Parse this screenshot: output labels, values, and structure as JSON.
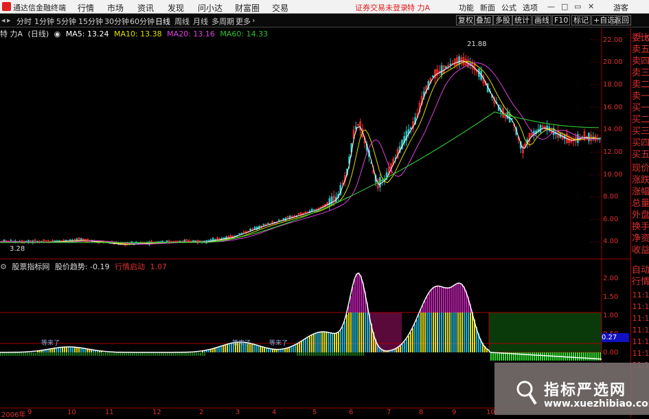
{
  "menubar": {
    "app_title": "通达信金融终端",
    "items": [
      "行情",
      "市场",
      "资讯",
      "发现",
      "问小达",
      "财富圈",
      "交易"
    ],
    "login_note": "证券交易未登录",
    "stock_name": "特 力A",
    "right_items": [
      "功能",
      "新面",
      "公式",
      "选项"
    ],
    "guest": "游客"
  },
  "toolbar": {
    "periods": [
      "分时",
      "1分钟",
      "5分钟",
      "15分钟",
      "30分钟",
      "60分钟",
      "日线",
      "周线",
      "月线",
      "多周期",
      "更多"
    ],
    "active_period": "日线",
    "right_buttons": [
      "复权",
      "叠加",
      "多股",
      "统计",
      "画线",
      "F10",
      "标记",
      "+自选",
      "返回"
    ]
  },
  "main_info": {
    "stock": "特 力A",
    "period_tag": "(日线)",
    "ma5": "MA5: 13.24",
    "ma10": "MA10: 13.38",
    "ma20": "MA20: 13.16",
    "ma60": "MA60: 14.33",
    "high_label": "21.88",
    "low_label": "3.28"
  },
  "indicator_info": {
    "name": "股票指标网",
    "trend_label": "股价趋势: -0.19",
    "signal": "行情启动",
    "signal_value": "1.07",
    "current_value": "0.27",
    "bar_notes": [
      "等来了",
      "等来了",
      "等来了"
    ]
  },
  "price_axis": [
    "22.00",
    "20.00",
    "18.00",
    "16.00",
    "14.00",
    "12.00",
    "10.00",
    "8.00",
    "6.00",
    "4.00"
  ],
  "ind_axis": [
    "2.00",
    "1.50",
    "1.00",
    "0.50",
    "0.00"
  ],
  "x_axis": [
    "2006年",
    "9",
    "10",
    "11",
    "12",
    "2",
    "3",
    "4",
    "5",
    "6",
    "7",
    "8",
    "9",
    "10"
  ],
  "side_tabs": [
    "委比",
    "卖五",
    "卖四",
    "卖三",
    "卖二",
    "卖一",
    "买一",
    "买二",
    "买三",
    "买四",
    "买五",
    "现价",
    "涨跌",
    "涨幅",
    "总量",
    "外盘",
    "换手",
    "净资",
    "收益"
  ],
  "side_tabs2": [
    "自动",
    "行情",
    "11:1",
    "11:1",
    "11:1",
    "11:1",
    "11:1",
    "11:1",
    "11:1"
  ],
  "watermark": {
    "cn": "指标严选网",
    "en": "www.xuezhibiao.com"
  },
  "colors": {
    "up": "#ff3030",
    "down": "#30c0c0",
    "ma5": "#ffffff",
    "ma10": "#e0e000",
    "ma20": "#e040e0",
    "ma60": "#30c030"
  }
}
